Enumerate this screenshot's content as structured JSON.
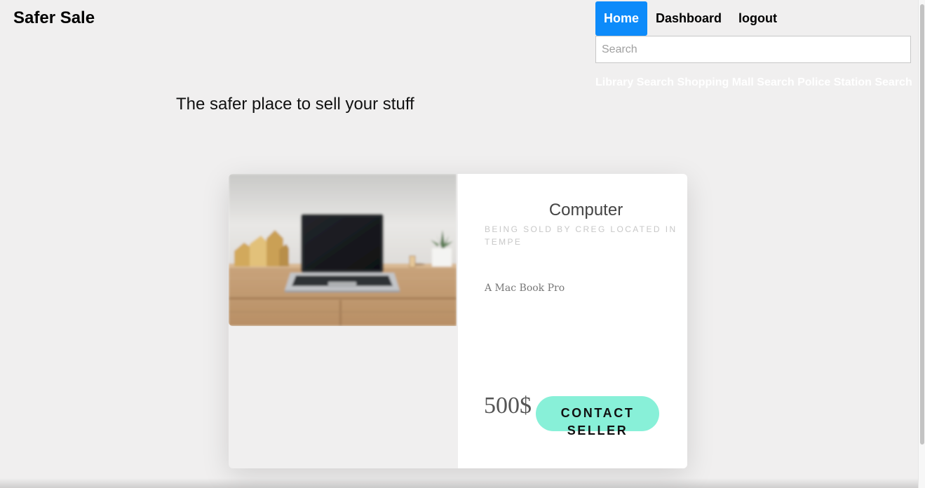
{
  "brand": {
    "title": "Safer Sale"
  },
  "nav": {
    "items": [
      {
        "label": "Home",
        "active": true
      },
      {
        "label": "Dashboard",
        "active": false
      },
      {
        "label": "logout",
        "active": false
      }
    ]
  },
  "search": {
    "placeholder": "Search",
    "value": ""
  },
  "search_links": {
    "library": "Library Search",
    "mall": "Shopping Mall Search",
    "police": "Police Station Search"
  },
  "hero": {
    "tagline": "The safer place to sell your stuff"
  },
  "listing": {
    "title": "Computer",
    "seller_info": "Being sold by Creg located in Tempe",
    "description": "A Mac Book Pro",
    "price": "500$",
    "contact_label": "Contact Seller",
    "image_icon": "laptop-photo"
  },
  "colors": {
    "accent_blue": "#0d8bfa",
    "contact_button": "#88f0d8",
    "page_background": "#f0efef"
  }
}
